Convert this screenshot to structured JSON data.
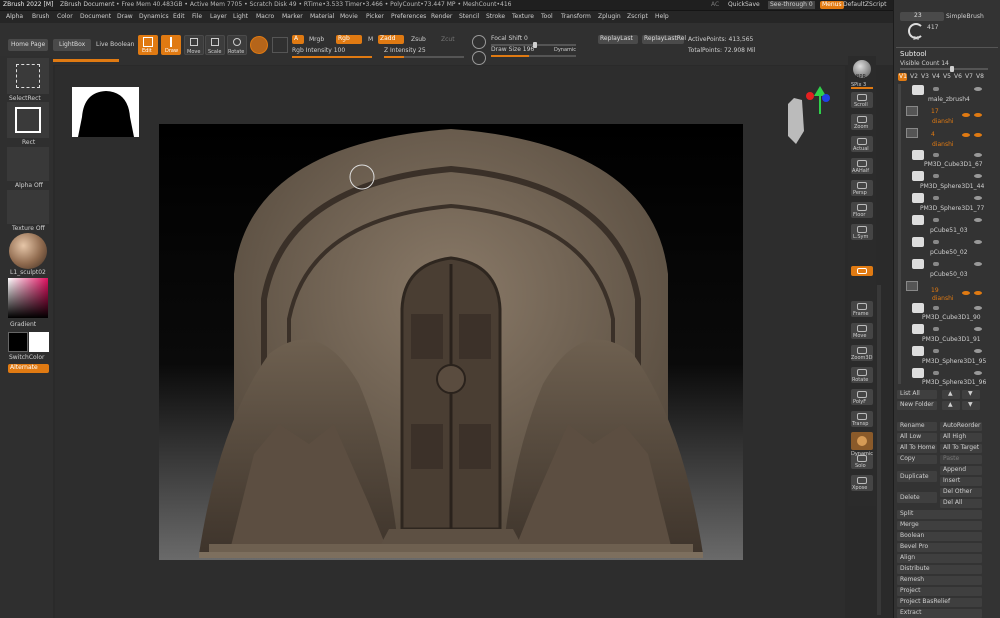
{
  "titlebar": {
    "app": "ZBrush 2022 [M]",
    "doc": "ZBrush Document",
    "stats": "• Free Mem 40.483GB • Active Mem 7705 • Scratch Disk 49 • RTime•3.533 Timer•3.466 • PolyCount•73.447 MP • MeshCount•416",
    "ac": "AC",
    "quicksave": "QuickSave",
    "seethrough": "See-through  0",
    "menus": "Menus",
    "script": "DefaultZScript"
  },
  "menus": [
    "Alpha",
    "Brush",
    "Color",
    "Document",
    "Draw",
    "Dynamics",
    "Edit",
    "File",
    "Layer",
    "Light",
    "Macro",
    "Marker",
    "Material",
    "Movie",
    "Picker",
    "Preferences",
    "Render",
    "Stencil",
    "Stroke",
    "Texture",
    "Tool",
    "Transform",
    "Zplugin",
    "Zscript",
    "Help"
  ],
  "shelf": {
    "home": "Home Page",
    "lightbox": "LightBox",
    "liveboolean": "Live Boolean",
    "edit": "Edit",
    "draw": "Draw",
    "move": "Move",
    "scale": "Scale",
    "rotate": "Rotate",
    "a": "A",
    "mrgb": "Mrgb",
    "rgb": "Rgb",
    "m": "M",
    "zadd": "Zadd",
    "zsub": "Zsub",
    "zcut": "Zcut",
    "rgb_intensity": "Rgb Intensity 100",
    "z_intensity": "Z Intensity 25",
    "focal_shift": "Focal Shift 0",
    "draw_size": "Draw Size 196",
    "dynamic": "Dynamic",
    "replaylast": "ReplayLast",
    "replaylastrel": "ReplayLastRel",
    "activepoints": "ActivePoints: 413,565",
    "totalpoints": "TotalPoints: 72.908 Mil"
  },
  "left": {
    "selectrect": "SelectRect",
    "rect": "Rect",
    "alphaoff": "Alpha Off",
    "textureoff": "Texture Off",
    "material": "L1_sculpt02",
    "gradient": "Gradient",
    "switchcolor": "SwitchColor",
    "alternate": "Alternate"
  },
  "right_shelf": [
    "BPR",
    "SPix 3",
    "Scroll",
    "Zoom",
    "Actual",
    "AAHalf",
    "Persp",
    "Floor",
    "L.Sym",
    "Frame",
    "Move",
    "Zoom3D",
    "Rotate",
    "PolyF",
    "Transp",
    "Dynamic",
    "Solo",
    "Xpose"
  ],
  "tray": {
    "top_num": "23",
    "simplebrush": "SimpleBrush",
    "brush_count": "417",
    "brush_small": "23",
    "subtool": "Subtool",
    "visible_count": "Visible Count 14",
    "versions": [
      "V1",
      "V2",
      "V3",
      "V4",
      "V5",
      "V6",
      "V7",
      "V8"
    ],
    "items": [
      {
        "name": "male_zbrush4",
        "kind": "mesh"
      },
      {
        "name": "17",
        "sub": "dianshi",
        "kind": "folder"
      },
      {
        "name": "4",
        "sub": "dianshi",
        "kind": "folder"
      },
      {
        "name": "PM3D_Cube3D1_67",
        "kind": "mesh"
      },
      {
        "name": "PM3D_Sphere3D1_44",
        "kind": "mesh"
      },
      {
        "name": "PM3D_Sphere3D1_77",
        "kind": "mesh"
      },
      {
        "name": "pCube51_03",
        "kind": "mesh"
      },
      {
        "name": "pCube50_02",
        "kind": "mesh"
      },
      {
        "name": "pCube50_03",
        "kind": "mesh"
      },
      {
        "name": "19",
        "sub": "dianshi",
        "kind": "folder"
      },
      {
        "name": "PM3D_Cube3D1_90",
        "kind": "mesh"
      },
      {
        "name": "PM3D_Cube3D1_91",
        "kind": "mesh"
      },
      {
        "name": "PM3D_Sphere3D1_95",
        "kind": "mesh"
      },
      {
        "name": "PM3D_Sphere3D1_96",
        "kind": "mesh"
      }
    ],
    "listall": "List All",
    "newfolder": "New Folder",
    "rename": "Rename",
    "autoreorder": "AutoReorder",
    "alllow": "All Low",
    "allhigh": "All High",
    "alltohome": "All To Home",
    "alltotarget": "All To Target",
    "copy": "Copy",
    "paste": "Paste",
    "append": "Append",
    "duplicate": "Duplicate",
    "insert": "Insert",
    "delete": "Delete",
    "delother": "Del Other",
    "delall": "Del All",
    "sections": [
      "Split",
      "Merge",
      "Boolean",
      "Bevel Pro",
      "Align",
      "Distribute",
      "Remesh",
      "Project",
      "Project BasRelief",
      "Extract"
    ]
  },
  "colors": {
    "accent": "#e07a12",
    "panel": "#333333",
    "bg": "#2a2a2a"
  }
}
